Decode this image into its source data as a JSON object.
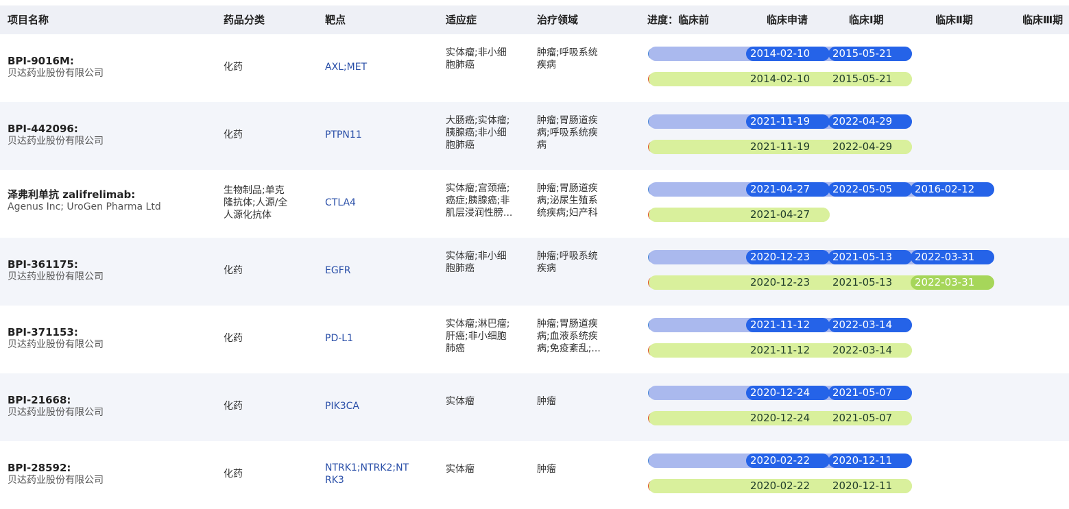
{
  "header": {
    "name": "项目名称",
    "category": "药品分类",
    "target": "靶点",
    "indication": "适应症",
    "area": "治疗领域",
    "preclinical": "进度：临床前",
    "application": "临床申请",
    "phase1": "临床Ⅰ期",
    "phase2": "临床Ⅱ期",
    "phase3": "临床Ⅲ期"
  },
  "rows": [
    {
      "title": "BPI-9016M:",
      "company": "贝达药业股份有限公司",
      "category": [
        "化药"
      ],
      "target": [
        "AXL;MET"
      ],
      "indication": [
        "实体瘤;非小细",
        "胞肺癌"
      ],
      "area": [
        "肿瘤;呼吸系统",
        "疾病"
      ],
      "intl": [
        "2014-02-10",
        "2015-05-21"
      ],
      "cn": [
        "2014-02-10",
        "2015-05-21"
      ]
    },
    {
      "title": "BPI-442096:",
      "company": "贝达药业股份有限公司",
      "category": [
        "化药"
      ],
      "target": [
        "PTPN11"
      ],
      "indication": [
        "大肠癌;实体瘤;",
        "胰腺癌;非小细",
        "胞肺癌"
      ],
      "area": [
        "肿瘤;胃肠道疾",
        "病;呼吸系统疾",
        "病"
      ],
      "intl": [
        "2021-11-19",
        "2022-04-29"
      ],
      "cn": [
        "2021-11-19",
        "2022-04-29"
      ]
    },
    {
      "title": "泽弗利单抗 zalifrelimab:",
      "company": "Agenus Inc; UroGen Pharma Ltd",
      "category": [
        "生物制品;单克",
        "隆抗体;人源/全",
        "人源化抗体"
      ],
      "target": [
        "CTLA4"
      ],
      "indication": [
        "实体瘤;宫颈癌;",
        "癌症;胰腺癌;非",
        "肌层浸润性膀..."
      ],
      "area": [
        "肿瘤;胃肠道疾",
        "病;泌尿生殖系",
        "统疾病;妇产科"
      ],
      "intl": [
        "2021-04-27",
        "2022-05-05",
        "2016-02-12"
      ],
      "cn": [
        "2021-04-27"
      ]
    },
    {
      "title": "BPI-361175:",
      "company": "贝达药业股份有限公司",
      "category": [
        "化药"
      ],
      "target": [
        "EGFR"
      ],
      "indication": [
        "实体瘤;非小细",
        "胞肺癌"
      ],
      "area": [
        "肿瘤;呼吸系统",
        "疾病"
      ],
      "intl": [
        "2020-12-23",
        "2021-05-13",
        "2022-03-31"
      ],
      "cn": [
        "2020-12-23",
        "2021-05-13",
        "2022-03-31"
      ]
    },
    {
      "title": "BPI-371153:",
      "company": "贝达药业股份有限公司",
      "category": [
        "化药"
      ],
      "target": [
        "PD-L1"
      ],
      "indication": [
        "实体瘤;淋巴瘤;",
        "肝癌;非小细胞",
        "肺癌"
      ],
      "area": [
        "肿瘤;胃肠道疾",
        "病;血液系统疾",
        "病;免疫紊乱;..."
      ],
      "intl": [
        "2021-11-12",
        "2022-03-14"
      ],
      "cn": [
        "2021-11-12",
        "2022-03-14"
      ]
    },
    {
      "title": "BPI-21668:",
      "company": "贝达药业股份有限公司",
      "category": [
        "化药"
      ],
      "target": [
        "PIK3CA"
      ],
      "indication": [
        "实体瘤"
      ],
      "area": [
        "肿瘤"
      ],
      "intl": [
        "2020-12-24",
        "2021-05-07"
      ],
      "cn": [
        "2020-12-24",
        "2021-05-07"
      ]
    },
    {
      "title": "BPI-28592:",
      "company": "贝达药业股份有限公司",
      "category": [
        "化药"
      ],
      "target": [
        "NTRK1;NTRK2;NT",
        "RK3"
      ],
      "indication": [
        "实体瘤"
      ],
      "area": [
        "肿瘤"
      ],
      "intl": [
        "2020-02-22",
        "2020-12-11"
      ],
      "cn": [
        "2020-02-22",
        "2020-12-11"
      ]
    }
  ],
  "colors": {
    "header_bg": "#eef0f6",
    "alt_row_bg": "#f3f5fa",
    "intl_bar_light": "#aab9ee",
    "intl_bar_dark": "#2563e8",
    "cn_bar": "#d9f09c",
    "cn_bar_dark": "#a6d65a",
    "target_link": "#2a4fa8"
  },
  "icons": {
    "intl_flag": "globe-icon",
    "cn_flag": "china-flag-icon"
  }
}
